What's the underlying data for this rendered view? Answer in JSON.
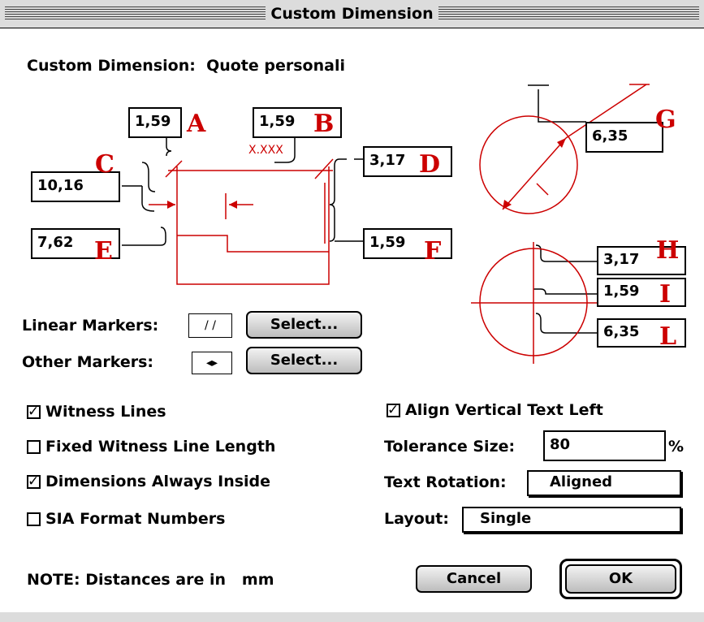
{
  "window": {
    "title": "Custom Dimension"
  },
  "header": {
    "label": "Custom Dimension:",
    "value": "Quote personali"
  },
  "diagram": {
    "fields": {
      "A": "1,59",
      "B": "1,59",
      "C": "10,16",
      "D": "3,17",
      "E": "7,62",
      "F": "1,59",
      "G": "6,35",
      "H": "3,17",
      "I": "1,59",
      "L": "6,35"
    },
    "letters": {
      "A": "A",
      "B": "B",
      "C": "C",
      "D": "D",
      "E": "E",
      "F": "F",
      "G": "G",
      "H": "H",
      "I": "I",
      "L": "L"
    },
    "sample_text": "X.XXX",
    "accent_color": "#cc0000"
  },
  "markers": {
    "linear_label": "Linear Markers:",
    "linear_glyph": "/ /",
    "other_label": "Other Markers:",
    "other_glyph": "◂▸",
    "select_label": "Select..."
  },
  "options": {
    "witness_lines": {
      "label": "Witness Lines",
      "checked": true
    },
    "fixed_witness": {
      "label": "Fixed Witness Line Length",
      "checked": false
    },
    "always_inside": {
      "label": "Dimensions Always Inside",
      "checked": true
    },
    "sia_format": {
      "label": "SIA Format Numbers",
      "checked": false
    },
    "align_vertical": {
      "label": "Align Vertical Text Left",
      "checked": true
    }
  },
  "settings": {
    "tolerance_label": "Tolerance Size:",
    "tolerance_value": "80",
    "tolerance_unit": "%",
    "rotation_label": "Text Rotation:",
    "rotation_value": "Aligned",
    "layout_label": "Layout:",
    "layout_value": "Single"
  },
  "note": {
    "prefix": "NOTE: Distances are in",
    "unit": "mm"
  },
  "buttons": {
    "cancel": "Cancel",
    "ok": "OK"
  }
}
